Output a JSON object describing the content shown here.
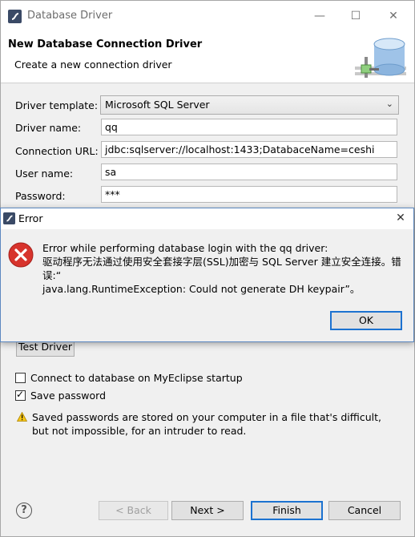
{
  "window": {
    "title": "Database Driver",
    "controls": {
      "minimize": "—",
      "maximize": "☐",
      "close": "✕"
    }
  },
  "banner": {
    "title": "New Database Connection Driver",
    "subtitle": "Create a new connection driver"
  },
  "form": {
    "driver_template": {
      "label": "Driver template:",
      "value": "Microsoft SQL Server"
    },
    "driver_name": {
      "label": "Driver name:",
      "value": "qq"
    },
    "connection_url": {
      "label": "Connection URL:",
      "value": "jdbc:sqlserver://localhost:1433;DatabaceName=ceshi"
    },
    "user_name": {
      "label": "User name:",
      "value": "sa"
    },
    "password": {
      "label": "Password:",
      "value": "***"
    }
  },
  "test_driver_label": "Test Driver",
  "options": {
    "connect_on_startup": {
      "label": "Connect to database on MyEclipse startup",
      "checked": false
    },
    "save_password": {
      "label": "Save password",
      "checked": true
    }
  },
  "warning": {
    "text": "Saved passwords are stored on your computer in a file that's difficult, but not impossible, for an intruder to read."
  },
  "footer": {
    "help": "?",
    "back_label": "< Back",
    "next_label": "Next >",
    "finish_label": "Finish",
    "cancel_label": "Cancel"
  },
  "error_dialog": {
    "title": "Error",
    "close": "✕",
    "message_line1": "Error while performing database login with the qq driver:",
    "message_line2": "驱动程序无法通过使用安全套接字层(SSL)加密与 SQL Server 建立安全连接。错误:“",
    "message_line3": "java.lang.RuntimeException: Could not generate DH keypair”。",
    "ok_label": "OK"
  },
  "colors": {
    "dialog_bg": "#f0f0f0",
    "error_icon": "#d7332c",
    "accent_border": "#1c72d0"
  }
}
